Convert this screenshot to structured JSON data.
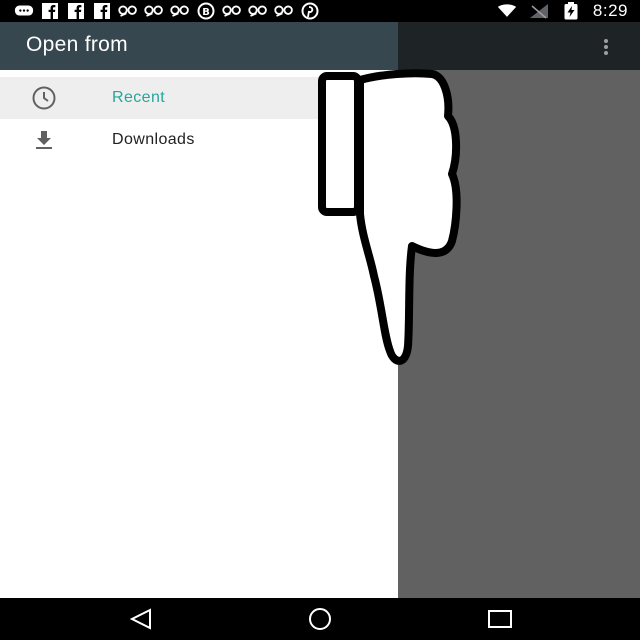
{
  "status_bar": {
    "time": "8:29",
    "notification_icons": [
      "messaging-icon",
      "facebook-icon",
      "facebook-icon",
      "facebook-icon",
      "app-icon",
      "app-icon",
      "app-icon",
      "app-icon",
      "app-icon",
      "app-icon",
      "app-icon",
      "pinterest-icon"
    ],
    "system_icons": [
      "wifi-icon",
      "signal-icon",
      "battery-charging-icon"
    ]
  },
  "drawer": {
    "title": "Open from",
    "items": [
      {
        "label": "Recent",
        "icon": "clock-icon",
        "selected": true
      },
      {
        "label": "Downloads",
        "icon": "download-icon",
        "selected": false
      }
    ]
  },
  "toolbar": {
    "overflow_icon": "more-vert-icon"
  },
  "navigation": {
    "buttons": [
      "back-icon",
      "home-icon",
      "recents-icon"
    ]
  },
  "colors": {
    "drawer_header": "#37474f",
    "selected_text": "#26a69a",
    "scrim": "#616161"
  }
}
